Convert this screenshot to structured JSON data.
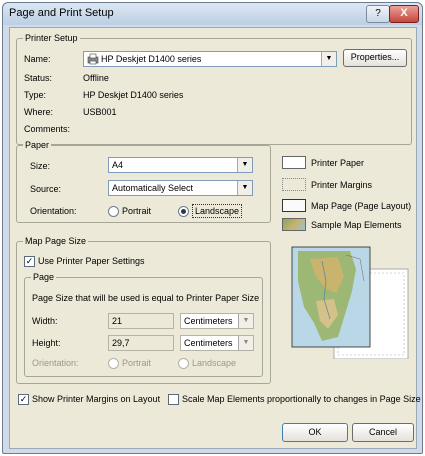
{
  "title": "Page and Print Setup",
  "printer_setup": {
    "legend": "Printer Setup",
    "name_label": "Name:",
    "name_value": "HP Deskjet D1400 series",
    "properties_label": "Properties...",
    "status_label": "Status:",
    "status_value": "Offline",
    "type_label": "Type:",
    "type_value": "HP Deskjet D1400 series",
    "where_label": "Where:",
    "where_value": "USB001",
    "comments_label": "Comments:"
  },
  "paper": {
    "legend": "Paper",
    "size_label": "Size:",
    "size_value": "A4",
    "source_label": "Source:",
    "source_value": "Automatically Select",
    "orientation_label": "Orientation:",
    "portrait_label": "Portrait",
    "landscape_label": "Landscape",
    "selected": "Landscape"
  },
  "legend_items": [
    "Printer Paper",
    "Printer Margins",
    "Map Page (Page Layout)",
    "Sample Map Elements"
  ],
  "map_page_size": {
    "legend": "Map Page Size",
    "use_printer_label": "Use Printer Paper Settings",
    "use_printer_checked": true,
    "page_legend": "Page",
    "page_note": "Page Size that will be used is equal to Printer Paper Size",
    "width_label": "Width:",
    "width_value": "21",
    "width_unit": "Centimeters",
    "height_label": "Height:",
    "height_value": "29,7",
    "height_unit": "Centimeters",
    "orientation_label": "Orientation:",
    "portrait_label": "Portrait",
    "landscape_label": "Landscape"
  },
  "options": {
    "show_margins_label": "Show Printer Margins on Layout",
    "show_margins_checked": true,
    "scale_label": "Scale Map Elements proportionally to changes in Page Size",
    "scale_checked": false
  },
  "buttons": {
    "ok": "OK",
    "cancel": "Cancel",
    "help": "?",
    "close": "X"
  },
  "colors": {
    "title_bar": "#bccfe4",
    "close_button": "#c7463a",
    "dialog_face": "#ece9d8"
  }
}
